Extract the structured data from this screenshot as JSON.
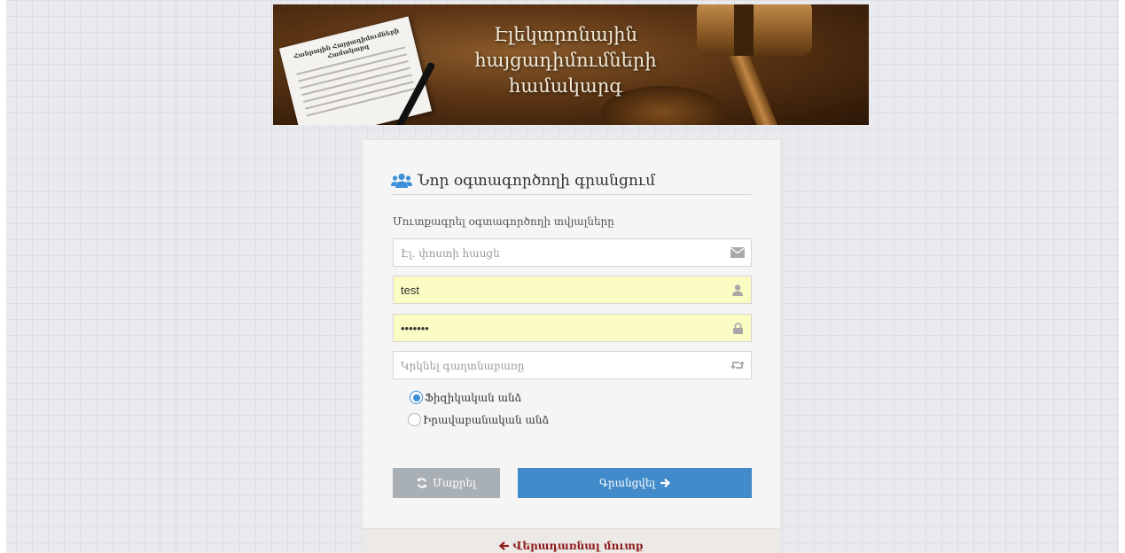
{
  "banner": {
    "title_line1": "Էլեկտրոնային",
    "title_line2": "հայցադիմումների",
    "title_line3": "համակարգ",
    "paper_title": "Հանրային Հայցադիմումների Համակարգ"
  },
  "form": {
    "title": "Նոր օգտագործողի գրանցում",
    "subtitle": "Մուտքագրել օգտագործողի տվյալները",
    "email": {
      "placeholder": "Էլ. փոստի հասցե",
      "value": "",
      "icon": "envelope-icon"
    },
    "username": {
      "placeholder": "",
      "value": "test",
      "icon": "user-icon"
    },
    "password": {
      "placeholder": "",
      "value": "•••••••",
      "icon": "lock-icon"
    },
    "repeat_password": {
      "placeholder": "Կրկնել գաղտնաբառը",
      "value": "",
      "icon": "retweet-icon"
    },
    "radios": [
      {
        "label": "Ֆիզիկական անձ",
        "checked": true
      },
      {
        "label": "Իրավաբանական անձ",
        "checked": false
      }
    ],
    "reset_label": "Մաքրել",
    "submit_label": "Գրանցվել"
  },
  "footer": {
    "back_label": "Վերադառնալ մուտք"
  },
  "colors": {
    "accent": "#428bca",
    "reset_button": "#a9b0b5",
    "autofill": "#fbfbc4",
    "back_link": "#8b1a1a"
  }
}
